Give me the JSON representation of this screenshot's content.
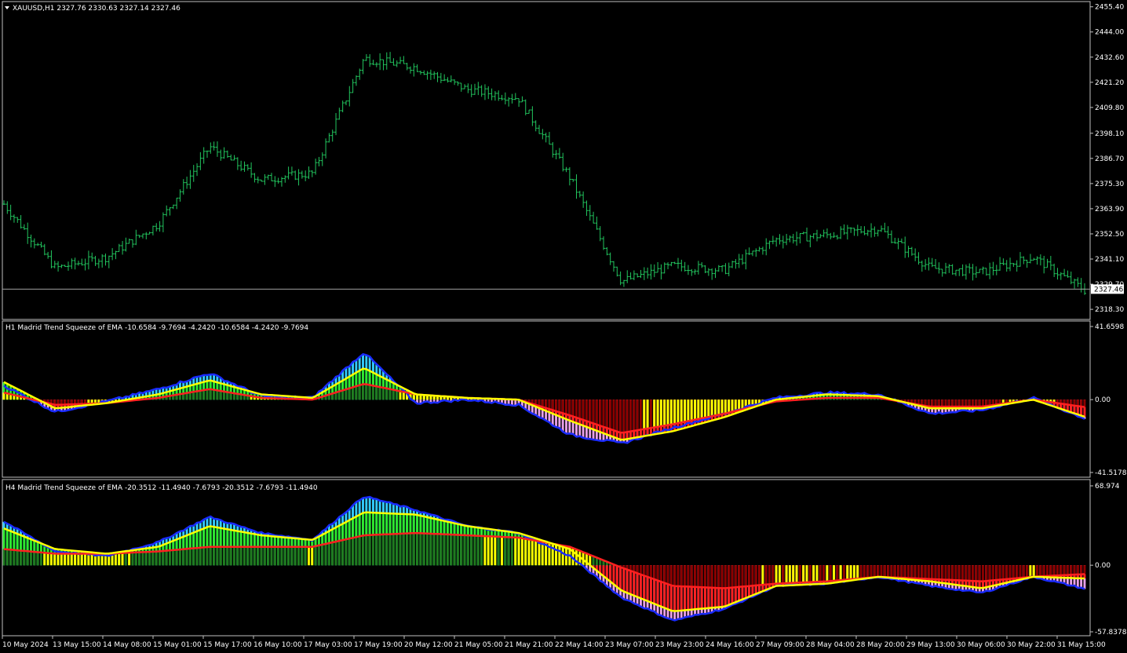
{
  "main": {
    "header": "XAUUSD,H1  2327.76 2330.63 2327.14 2327.46",
    "price_ticks": [
      "2455.40",
      "2444.00",
      "2432.60",
      "2421.20",
      "2409.80",
      "2398.10",
      "2386.70",
      "2375.30",
      "2363.90",
      "2352.50",
      "2341.10",
      "2329.70",
      "2318.30"
    ],
    "current_price_label": "2327.46",
    "current_price": 2327.46,
    "candle_color": "#22c55e"
  },
  "panel1": {
    "header": "H1 Madrid Trend Squeeze of EMA  -10.6584 -9.7694 -4.2420 -10.6584 -4.2420 -9.7694",
    "ticks": [
      "41.6598",
      "0.00",
      "-41.5178"
    ]
  },
  "panel2": {
    "header": "H4 Madrid Trend Squeeze of EMA  -20.3512 -11.4940 -7.6793 -20.3512 -7.6793 -11.4940",
    "ticks": [
      "68.974",
      "0.00",
      "-57.8378"
    ]
  },
  "x_ticks": [
    "10 May 2024",
    "13 May 15:00",
    "14 May 08:00",
    "15 May 01:00",
    "15 May 17:00",
    "16 May 10:00",
    "17 May 03:00",
    "17 May 19:00",
    "20 May 12:00",
    "21 May 05:00",
    "21 May 21:00",
    "22 May 14:00",
    "23 May 07:00",
    "23 May 23:00",
    "24 May 16:00",
    "27 May 09:00",
    "28 May 04:00",
    "28 May 20:00",
    "29 May 13:00",
    "30 May 06:00",
    "30 May 22:00",
    "31 May 15:00"
  ],
  "colors": {
    "bg": "#000000",
    "frame": "#c0c0c0",
    "bull": "#22c55e",
    "dark_green": "#1f7a1f",
    "lime": "#2ee82e",
    "cyan": "#33ccff",
    "yellow": "#ffff00",
    "red": "#ff2020",
    "dark_red": "#8b0000",
    "pink": "#e8a0e8",
    "blue": "#1a2bff"
  },
  "chart_data": [
    {
      "type": "line",
      "title": "XAUUSD,H1",
      "x": [
        "10 May 2024",
        "13 May 15:00",
        "14 May 08:00",
        "15 May 01:00",
        "15 May 17:00",
        "16 May 10:00",
        "17 May 03:00",
        "17 May 19:00",
        "20 May 12:00",
        "21 May 05:00",
        "21 May 21:00",
        "22 May 14:00",
        "23 May 07:00",
        "23 May 23:00",
        "24 May 16:00",
        "27 May 09:00",
        "28 May 04:00",
        "28 May 20:00",
        "29 May 13:00",
        "30 May 06:00",
        "30 May 22:00",
        "31 May 15:00"
      ],
      "series": [
        {
          "name": "XAUUSD",
          "values": [
            2366,
            2337,
            2342,
            2357,
            2392,
            2377,
            2380,
            2432,
            2428,
            2418,
            2414,
            2378,
            2331,
            2338,
            2336,
            2350,
            2352,
            2355,
            2337,
            2335,
            2342,
            2327
          ]
        }
      ],
      "ylim": [
        2315.5,
        2456
      ]
    },
    {
      "type": "line",
      "title": "H1 Madrid Trend Squeeze of EMA",
      "x": [
        "10 May 2024",
        "13 May 15:00",
        "14 May 08:00",
        "15 May 01:00",
        "15 May 17:00",
        "16 May 10:00",
        "17 May 03:00",
        "17 May 19:00",
        "20 May 12:00",
        "21 May 05:00",
        "21 May 21:00",
        "22 May 14:00",
        "23 May 07:00",
        "23 May 23:00",
        "24 May 16:00",
        "27 May 09:00",
        "28 May 04:00",
        "28 May 20:00",
        "29 May 13:00",
        "30 May 06:00",
        "30 May 22:00",
        "31 May 15:00"
      ],
      "series": [
        {
          "name": "fast",
          "values": [
            8,
            -7,
            -1,
            6,
            15,
            2,
            1,
            27,
            -2,
            0,
            -3,
            -20,
            -25,
            -16,
            -8,
            1,
            4,
            3,
            -8,
            -6,
            1,
            -10.66
          ]
        },
        {
          "name": "signal",
          "values": [
            10,
            -5,
            -2,
            3,
            11,
            3,
            1,
            18,
            3,
            1,
            0,
            -12,
            -23,
            -18,
            -10,
            0,
            3,
            2,
            -5,
            -5,
            0,
            -9.77
          ]
        },
        {
          "name": "slow",
          "values": [
            4,
            -3,
            -2,
            1,
            6,
            1,
            0,
            9,
            3,
            1,
            0,
            -9,
            -19,
            -14,
            -8,
            -1,
            1,
            1,
            -4,
            -4,
            0,
            -4.24
          ]
        }
      ],
      "ylim": [
        -41.5178,
        41.6598
      ]
    },
    {
      "type": "line",
      "title": "H4 Madrid Trend Squeeze of EMA",
      "x": [
        "10 May 2024",
        "13 May 15:00",
        "14 May 08:00",
        "15 May 01:00",
        "15 May 17:00",
        "16 May 10:00",
        "17 May 03:00",
        "17 May 19:00",
        "20 May 12:00",
        "21 May 05:00",
        "21 May 21:00",
        "22 May 14:00",
        "23 May 07:00",
        "23 May 23:00",
        "24 May 16:00",
        "27 May 09:00",
        "28 May 04:00",
        "28 May 20:00",
        "29 May 13:00",
        "30 May 06:00",
        "30 May 22:00",
        "31 May 15:00"
      ],
      "series": [
        {
          "name": "fast",
          "values": [
            38,
            12,
            8,
            20,
            42,
            28,
            22,
            60,
            48,
            34,
            28,
            8,
            -28,
            -48,
            -38,
            -18,
            -16,
            -10,
            -18,
            -24,
            -10,
            -20.35
          ]
        },
        {
          "name": "signal",
          "values": [
            32,
            14,
            10,
            16,
            34,
            26,
            22,
            46,
            44,
            34,
            28,
            14,
            -22,
            -40,
            -36,
            -18,
            -16,
            -10,
            -14,
            -20,
            -10,
            -11.49
          ]
        },
        {
          "name": "slow",
          "values": [
            14,
            10,
            10,
            12,
            16,
            16,
            16,
            26,
            28,
            26,
            24,
            16,
            -2,
            -18,
            -20,
            -16,
            -14,
            -10,
            -12,
            -14,
            -10,
            -7.68
          ]
        }
      ],
      "ylim": [
        -57.8378,
        68.974
      ]
    }
  ]
}
